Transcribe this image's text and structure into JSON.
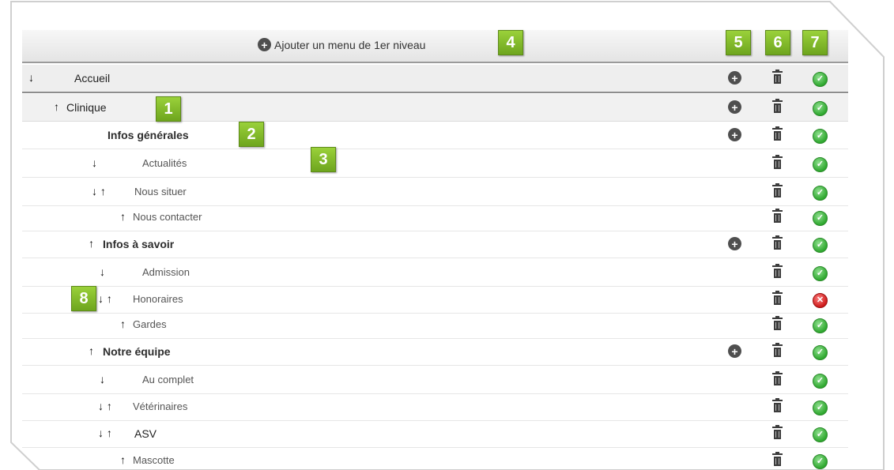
{
  "header": {
    "add_label": "Ajouter un menu de 1er niveau",
    "add_icon": "plus-circle-icon"
  },
  "columns": {
    "add_icon": "plus-circle-icon",
    "delete_icon": "trash-icon",
    "status_icon": "status-icon"
  },
  "rows": [
    {
      "label": "Accueil",
      "arrows": "↓",
      "status": "ok",
      "has_add": true
    },
    {
      "label": "Clinique",
      "arrows": "↑",
      "status": "ok",
      "has_add": true
    },
    {
      "label": "Infos générales",
      "arrows": "",
      "status": "ok",
      "has_add": true
    },
    {
      "label": "Actualités",
      "arrows": "↓",
      "status": "ok",
      "has_add": false
    },
    {
      "label": "Nous situer",
      "arrows": "↓ ↑",
      "status": "ok",
      "has_add": false
    },
    {
      "label": "Nous contacter",
      "arrows": "↑",
      "status": "ok",
      "has_add": false
    },
    {
      "label": "Infos à savoir",
      "arrows": "↑",
      "status": "ok",
      "has_add": true
    },
    {
      "label": "Admission",
      "arrows": "↓",
      "status": "ok",
      "has_add": false
    },
    {
      "label": "Honoraires",
      "arrows": "↓ ↑",
      "status": "off",
      "has_add": false
    },
    {
      "label": "Gardes",
      "arrows": "↑",
      "status": "ok",
      "has_add": false
    },
    {
      "label": "Notre équipe",
      "arrows": "↑",
      "status": "ok",
      "has_add": true
    },
    {
      "label": "Au complet",
      "arrows": "↓",
      "status": "ok",
      "has_add": false
    },
    {
      "label": "Vétérinaires",
      "arrows": "↓ ↑",
      "status": "ok",
      "has_add": false
    },
    {
      "label": "ASV",
      "arrows": "↓ ↑",
      "status": "ok",
      "has_add": false
    },
    {
      "label": "Mascotte",
      "arrows": "↑",
      "status": "ok",
      "has_add": false
    }
  ],
  "badges": [
    "1",
    "2",
    "3",
    "4",
    "5",
    "6",
    "7",
    "8"
  ],
  "colors": {
    "badge": "#7fb72a",
    "status_ok": "#2fa82f",
    "status_off": "#cc1a1a"
  }
}
